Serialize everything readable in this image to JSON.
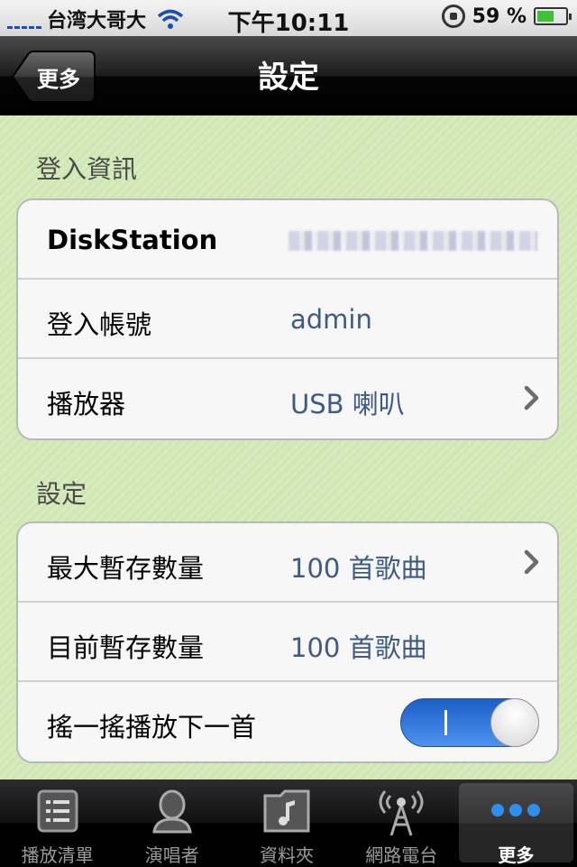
{
  "status_bar": {
    "carrier": "台湾大哥大",
    "time": "下午10:11",
    "battery": "59 %",
    "battery_level": 0.59
  },
  "nav": {
    "back_label": "更多",
    "title": "設定"
  },
  "login_section": {
    "header": "登入資訊",
    "rows": [
      {
        "label": "DiskStation",
        "value": ""
      },
      {
        "label": "登入帳號",
        "value": "admin"
      },
      {
        "label": "播放器",
        "value": "USB 喇叭"
      }
    ]
  },
  "settings_section": {
    "header": "設定",
    "rows": [
      {
        "label": "最大暫存數量",
        "value": "100 首歌曲"
      },
      {
        "label": "目前暫存數量",
        "value": "100 首歌曲"
      },
      {
        "label": "搖一搖播放下一首",
        "toggle": "on"
      }
    ]
  },
  "tabs": [
    {
      "label": "播放清單",
      "icon": "playlist-icon"
    },
    {
      "label": "演唱者",
      "icon": "artist-icon"
    },
    {
      "label": "資料夾",
      "icon": "folder-music-icon"
    },
    {
      "label": "網路電台",
      "icon": "radio-tower-icon"
    },
    {
      "label": "更多",
      "icon": "more-dots-icon",
      "active": true
    }
  ],
  "colors": {
    "content_bg": "#cfe7b2",
    "value_text": "#3f5a86",
    "toggle_on": "#2f78e0",
    "battery": "#3fc23a"
  }
}
